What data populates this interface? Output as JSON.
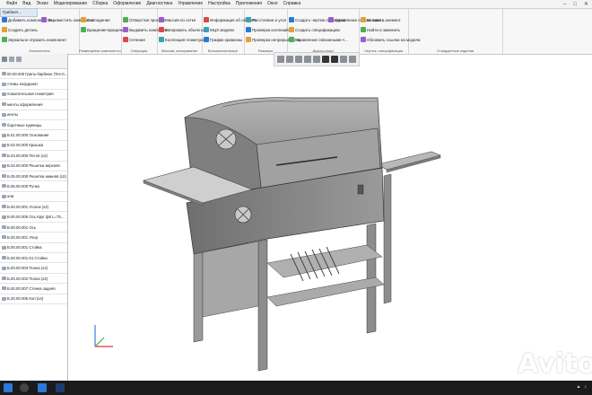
{
  "app": {
    "menu": [
      "Файл",
      "Вид",
      "Эскиз",
      "Моделирование",
      "Сборка",
      "Оформление",
      "Диагностика",
      "Управление",
      "Настройка",
      "Приложения",
      "Окно",
      "Справка"
    ],
    "doc_tab": "Грибнич..."
  },
  "ribbon": {
    "groups": [
      {
        "label": "Компоненты",
        "items": [
          "Добавить компонент из...",
          "Создать деталь",
          "Зеркально отразить компонент",
          "Переместить компонент"
        ]
      },
      {
        "label": "Размещение компонентов",
        "items": [
          "Совпадение",
          "Вращение-вращение"
        ]
      },
      {
        "label": "Операции",
        "items": [
          "Отверстие простое",
          "Выдавить компонент",
          "Сечение"
        ]
      },
      {
        "label": "Массив, копирование",
        "items": [
          "Массив по сетке",
          "Копировать объекты",
          "Коллекция геометрии"
        ]
      },
      {
        "label": "Вспомогательные",
        "items": [
          "Информация об объекте",
          "МЦХ модели",
          "График кривизны"
        ]
      },
      {
        "label": "Размеры",
        "items": [
          "Расстояние и угол",
          "Проверка коллизий",
          "Проверка непрерывности"
        ]
      },
      {
        "label": "Диагностика",
        "items": [
          "Создать чертеж по модели",
          "Создать спецификацию",
          "Управление связанными ч...",
          "Управление связанными с..."
        ]
      },
      {
        "label": "Чертеж, спецификация",
        "items": [
          "Вставить элемент",
          "Найти и заменить",
          "Обновить ссылки на модели"
        ]
      },
      {
        "label": "Стандартные изделия",
        "items": []
      }
    ]
  },
  "tree": {
    "rows": [
      "00.00.000 Гриль-барбекю (Тех-0...",
      "стемы координат",
      "помогательная геометрия",
      "менты оформления",
      "иенты",
      "борочные единицы",
      "Б.01.00.000 Основание",
      "Б.02.00.000 Крышка",
      "Б.03.00.000 Петля (x2)",
      "Б.04.00.000 Решетка верхняя",
      "Б.05.00.000 Решетка нижняя (x2)",
      "Б.05.00.000 Ручка",
      "али",
      "Б.00.00.001 Уголок (x2)",
      "Б.00.00.006 Ось Круг ф8 L=75...",
      "Б.00.00.001 Ось",
      "Б.00.00.001 Упор",
      "Б.00.00.001 Стойка",
      "Б.00.00.001-01 Стойка",
      "Б.00.00.003 Полка (x2)",
      "Б.00.00.002 Полка (x2)",
      "Б.00.00.007 Стенка задняя",
      "Б.20.00.005 Кол (x4)"
    ]
  },
  "viewport_tools": [
    "zoom-fit",
    "zoom",
    "rotate",
    "pan",
    "orient",
    "view-mode",
    "shading",
    "section",
    "filter"
  ],
  "watermark": "Avito",
  "colors": {
    "accent": "#2b79d4",
    "model_body": "#8e8e8e",
    "model_dark": "#5a5a5a",
    "model_light": "#bdbdbd",
    "viewport_bg": "#ffffff"
  }
}
